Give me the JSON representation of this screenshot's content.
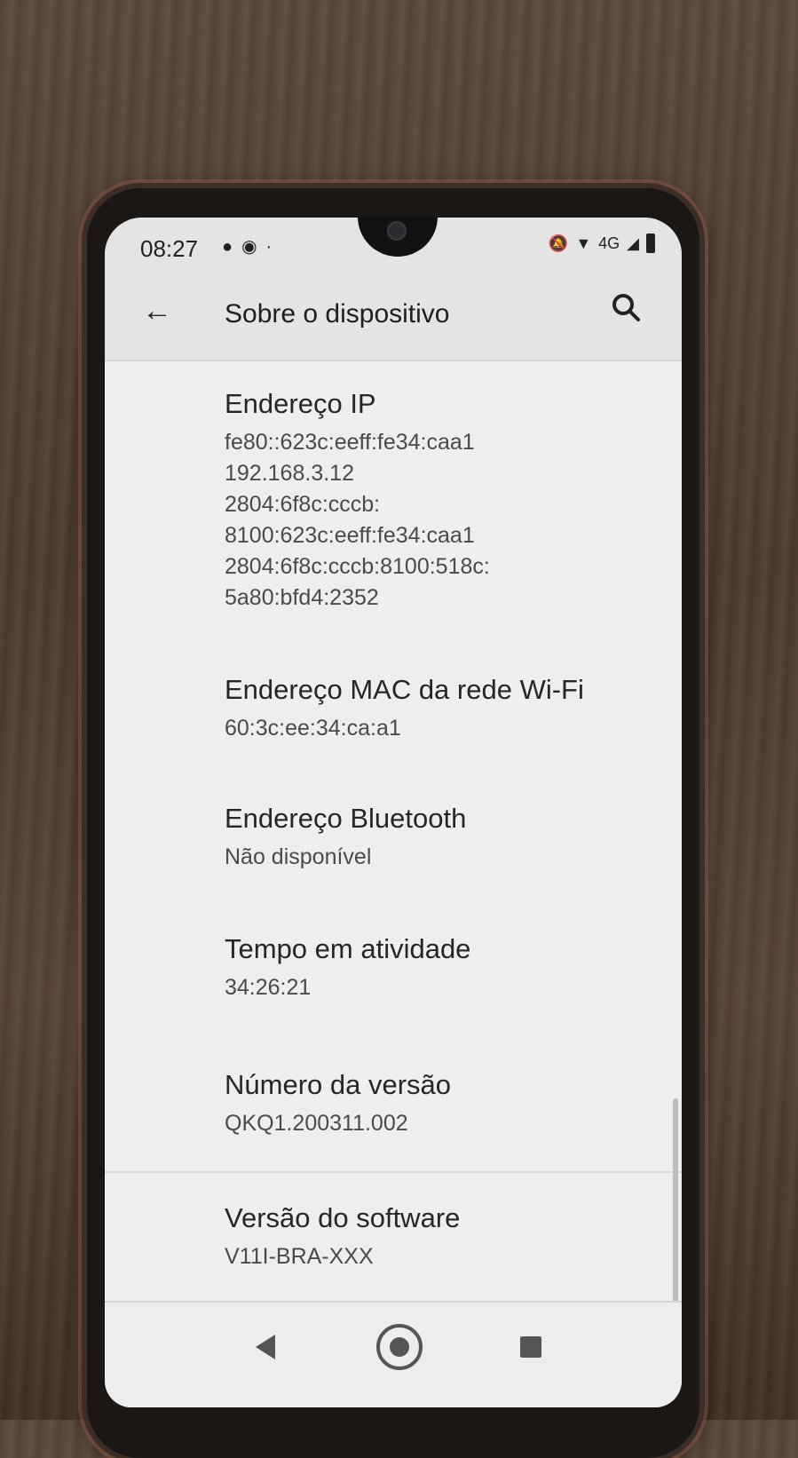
{
  "status_bar": {
    "time": "08:27",
    "network_label": "4G"
  },
  "app_bar": {
    "title": "Sobre o dispositivo"
  },
  "items": [
    {
      "title": "Endereço IP",
      "values": [
        "fe80::623c:eeff:fe34:caa1",
        "192.168.3.12",
        "2804:6f8c:cccb:",
        "8100:623c:eeff:fe34:caa1",
        "2804:6f8c:cccb:8100:518c:",
        "5a80:bfd4:2352"
      ]
    },
    {
      "title": "Endereço MAC da rede Wi-Fi",
      "values": [
        "60:3c:ee:34:ca:a1"
      ]
    },
    {
      "title": "Endereço Bluetooth",
      "values": [
        "Não disponível"
      ]
    },
    {
      "title": "Tempo em atividade",
      "values": [
        "34:26:21"
      ]
    },
    {
      "title": "Número da versão",
      "values": [
        "QKQ1.200311.002"
      ]
    },
    {
      "title": "Versão do software",
      "values": [
        "V11I-BRA-XXX"
      ]
    }
  ]
}
